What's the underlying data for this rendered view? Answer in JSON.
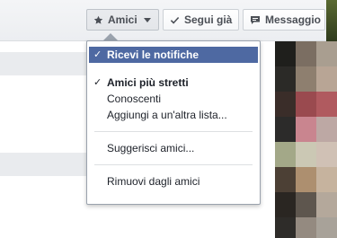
{
  "header": {
    "friends_button": {
      "label": "Amici",
      "icon": "star-icon"
    },
    "following_button": {
      "label": "Segui già",
      "icon": "checkmark-icon"
    },
    "message_button": {
      "label": "Messaggio",
      "icon": "message-icon"
    }
  },
  "menu": {
    "notifications": {
      "label": "Ricevi le notifiche",
      "checked": true
    },
    "close_friends": {
      "label": "Amici più stretti",
      "checked": true
    },
    "acquaintances": {
      "label": "Conoscenti"
    },
    "add_to_list": {
      "label": "Aggiungi a un'altra lista..."
    },
    "suggest_friends": {
      "label": "Suggerisci amici..."
    },
    "unfriend": {
      "label": "Rimuovi dagli amici"
    },
    "check_glyph": "✓"
  },
  "colors": {
    "highlight": "#4e69a2",
    "text": "#1d2129",
    "button_text": "#4b4f56"
  },
  "mosaic_colors": [
    "#1f1f1c",
    "#7b6e62",
    "#a99e90",
    "#2b2a27",
    "#8e7f6f",
    "#b8a595",
    "#3a2d29",
    "#9a4a4f",
    "#b05a5f",
    "#2c2b2a",
    "#c9858f",
    "#bda8a4",
    "#a3a888",
    "#cbc8b4",
    "#d0c1b5",
    "#4c4035",
    "#ad8f6f",
    "#c6b39e",
    "#2a2622",
    "#5e564e",
    "#b4a89b",
    "#2e2c29",
    "#948a80",
    "#a8a299"
  ]
}
